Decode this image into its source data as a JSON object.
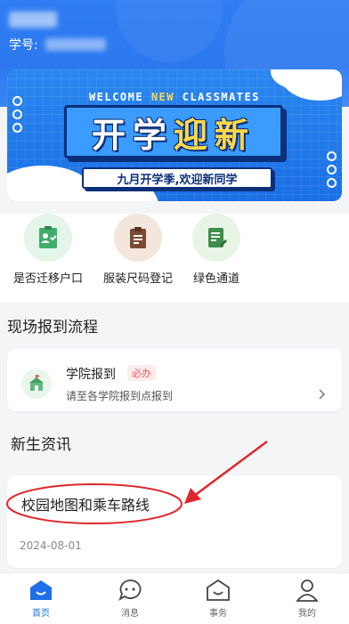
{
  "header": {
    "student_id_label": "学号:"
  },
  "banner": {
    "welcome_prefix": "WELCOME ",
    "welcome_highlight": "NEW",
    "welcome_suffix": " CLASSMATES",
    "title_part1": "开学",
    "title_part2": "迎新",
    "subtitle": "九月开学季,欢迎新同学"
  },
  "quick_actions": [
    {
      "label": "是否迁移户口",
      "icon": "id-card-icon",
      "color": "#3fae6a",
      "bg": "#e6f5ea"
    },
    {
      "label": "服装尺码登记",
      "icon": "clipboard-icon",
      "color": "#7a4a33",
      "bg": "#f3e6dd"
    },
    {
      "label": "绿色通道",
      "icon": "edit-document-icon",
      "color": "#3d8f4a",
      "bg": "#e8f4e6"
    }
  ],
  "onsite": {
    "section_title": "现场报到流程",
    "item_title": "学院报到",
    "item_badge": "必办",
    "item_desc": "请至各学院报到点报到"
  },
  "news": {
    "section_title": "新生资讯",
    "item_title": "校园地图和乘车路线",
    "item_date": "2024-08-01"
  },
  "tabbar": [
    {
      "label": "首页",
      "icon": "home-icon",
      "active": true
    },
    {
      "label": "消息",
      "icon": "message-icon",
      "active": false
    },
    {
      "label": "事务",
      "icon": "affairs-icon",
      "active": false
    },
    {
      "label": "我的",
      "icon": "profile-icon",
      "active": false
    }
  ],
  "colors": {
    "brand_blue": "#2f7df2",
    "annotation_red": "#e0262a",
    "badge_red": "#f05a5a"
  }
}
